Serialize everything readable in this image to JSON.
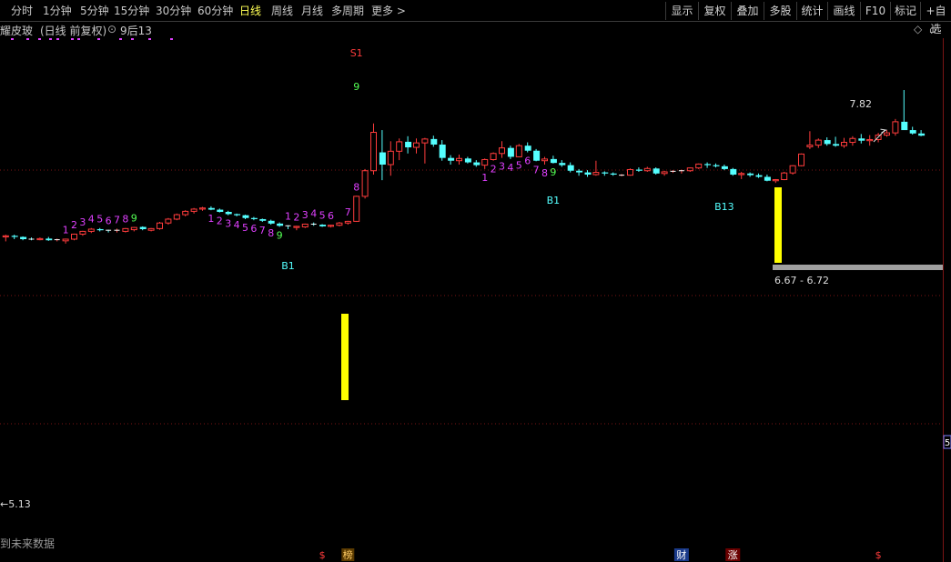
{
  "toolbar": {
    "periods": [
      "分时",
      "1分钟",
      "5分钟",
      "15分钟",
      "30分钟",
      "60分钟",
      "日线",
      "周线",
      "月线",
      "多周期",
      "更多 >"
    ],
    "active_period": "日线",
    "right_buttons": [
      "显示",
      "复权",
      "叠加",
      "多股",
      "统计",
      "画线",
      "F10",
      "标记",
      "+自选"
    ]
  },
  "infobar": {
    "stock_name": "耀皮玻",
    "mode": "(日线 前复权)",
    "indicator": "9后13",
    "right_icons": [
      "diamond-icon",
      "up-icon",
      "gear-icon"
    ]
  },
  "chart_data": {
    "type": "candlestick",
    "price_high_label": "7.82",
    "price_low_label": "5.13",
    "zone_label": "6.67 - 6.72",
    "right_axis_partial": "5",
    "footer_text": "到未来数据",
    "colors": {
      "up": "#ff3c3c",
      "down": "#54ffff",
      "gridline": "#7a1414",
      "signal_purple": "#e040ff",
      "signal_green": "#54ff54",
      "signal_cyan": "#54ffff",
      "zone_yellow": "#ffff00",
      "zone_gray": "#a0a0a0"
    },
    "candles": [
      [
        5.18,
        5.22,
        5.1,
        5.2
      ],
      [
        5.2,
        5.22,
        5.14,
        5.18
      ],
      [
        5.18,
        5.19,
        5.12,
        5.14
      ],
      [
        5.14,
        5.17,
        5.12,
        5.13
      ],
      [
        5.13,
        5.17,
        5.12,
        5.15
      ],
      [
        5.15,
        5.18,
        5.11,
        5.12
      ],
      [
        5.12,
        5.15,
        5.1,
        5.13
      ],
      [
        5.11,
        5.15,
        5.06,
        5.14
      ],
      [
        5.14,
        5.24,
        5.12,
        5.23
      ],
      [
        5.23,
        5.29,
        5.2,
        5.28
      ],
      [
        5.28,
        5.34,
        5.25,
        5.32
      ],
      [
        5.32,
        5.34,
        5.28,
        5.3
      ],
      [
        5.3,
        5.31,
        5.26,
        5.29
      ],
      [
        5.29,
        5.33,
        5.26,
        5.3
      ],
      [
        5.28,
        5.34,
        5.26,
        5.33
      ],
      [
        5.31,
        5.36,
        5.28,
        5.35
      ],
      [
        5.36,
        5.37,
        5.3,
        5.32
      ],
      [
        5.3,
        5.34,
        5.28,
        5.33
      ],
      [
        5.33,
        5.45,
        5.31,
        5.43
      ],
      [
        5.43,
        5.52,
        5.4,
        5.5
      ],
      [
        5.5,
        5.6,
        5.48,
        5.58
      ],
      [
        5.58,
        5.66,
        5.55,
        5.64
      ],
      [
        5.64,
        5.7,
        5.6,
        5.68
      ],
      [
        5.68,
        5.72,
        5.65,
        5.7
      ],
      [
        5.7,
        5.73,
        5.66,
        5.67
      ],
      [
        5.67,
        5.69,
        5.62,
        5.63
      ],
      [
        5.63,
        5.65,
        5.57,
        5.59
      ],
      [
        5.59,
        5.6,
        5.55,
        5.57
      ],
      [
        5.57,
        5.58,
        5.5,
        5.52
      ],
      [
        5.52,
        5.54,
        5.48,
        5.5
      ],
      [
        5.5,
        5.51,
        5.45,
        5.47
      ],
      [
        5.47,
        5.49,
        5.4,
        5.42
      ],
      [
        5.42,
        5.44,
        5.36,
        5.38
      ],
      [
        5.38,
        5.39,
        5.32,
        5.37
      ],
      [
        5.35,
        5.38,
        5.3,
        5.37
      ],
      [
        5.36,
        5.42,
        5.34,
        5.41
      ],
      [
        5.41,
        5.44,
        5.38,
        5.4
      ],
      [
        5.4,
        5.41,
        5.36,
        5.37
      ],
      [
        5.37,
        5.4,
        5.35,
        5.39
      ],
      [
        5.39,
        5.45,
        5.37,
        5.43
      ],
      [
        5.43,
        5.47,
        5.4,
        5.46
      ],
      [
        5.46,
        5.92,
        5.45,
        5.91
      ],
      [
        5.91,
        6.4,
        5.87,
        6.37
      ],
      [
        6.37,
        7.22,
        6.3,
        7.06
      ],
      [
        6.7,
        7.1,
        6.2,
        6.48
      ],
      [
        6.48,
        6.9,
        6.28,
        6.72
      ],
      [
        6.72,
        6.95,
        6.56,
        6.89
      ],
      [
        6.89,
        6.99,
        6.68,
        6.79
      ],
      [
        6.79,
        6.95,
        6.68,
        6.87
      ],
      [
        6.87,
        6.96,
        6.5,
        6.94
      ],
      [
        6.94,
        7.0,
        6.8,
        6.84
      ],
      [
        6.84,
        6.92,
        6.55,
        6.6
      ],
      [
        6.6,
        6.65,
        6.48,
        6.55
      ],
      [
        6.55,
        6.66,
        6.48,
        6.59
      ],
      [
        6.59,
        6.62,
        6.5,
        6.52
      ],
      [
        6.52,
        6.56,
        6.44,
        6.47
      ],
      [
        6.47,
        6.59,
        6.4,
        6.57
      ],
      [
        6.57,
        6.7,
        6.55,
        6.68
      ],
      [
        6.68,
        6.9,
        6.6,
        6.78
      ],
      [
        6.78,
        6.82,
        6.58,
        6.62
      ],
      [
        6.62,
        6.85,
        6.62,
        6.82
      ],
      [
        6.82,
        6.88,
        6.7,
        6.73
      ],
      [
        6.73,
        6.76,
        6.54,
        6.55
      ],
      [
        6.55,
        6.62,
        6.48,
        6.58
      ],
      [
        6.58,
        6.64,
        6.5,
        6.51
      ],
      [
        6.51,
        6.56,
        6.44,
        6.47
      ],
      [
        6.47,
        6.52,
        6.34,
        6.37
      ],
      [
        6.37,
        6.4,
        6.28,
        6.34
      ],
      [
        6.34,
        6.38,
        6.26,
        6.3
      ],
      [
        6.3,
        6.55,
        6.28,
        6.34
      ],
      [
        6.34,
        6.36,
        6.28,
        6.32
      ],
      [
        6.32,
        6.34,
        6.28,
        6.3
      ],
      [
        6.28,
        6.31,
        6.27,
        6.29
      ],
      [
        6.29,
        6.41,
        6.28,
        6.39
      ],
      [
        6.39,
        6.43,
        6.35,
        6.37
      ],
      [
        6.37,
        6.44,
        6.35,
        6.41
      ],
      [
        6.41,
        6.43,
        6.3,
        6.32
      ],
      [
        6.32,
        6.37,
        6.28,
        6.35
      ],
      [
        6.35,
        6.38,
        6.33,
        6.36
      ],
      [
        6.36,
        6.39,
        6.32,
        6.37
      ],
      [
        6.37,
        6.43,
        6.35,
        6.42
      ],
      [
        6.42,
        6.5,
        6.4,
        6.49
      ],
      [
        6.49,
        6.52,
        6.42,
        6.47
      ],
      [
        6.47,
        6.5,
        6.43,
        6.45
      ],
      [
        6.45,
        6.48,
        6.38,
        6.4
      ],
      [
        6.4,
        6.42,
        6.28,
        6.3
      ],
      [
        6.3,
        6.35,
        6.22,
        6.32
      ],
      [
        6.32,
        6.34,
        6.26,
        6.29
      ],
      [
        6.29,
        6.32,
        6.24,
        6.26
      ],
      [
        6.26,
        6.3,
        6.18,
        6.19
      ],
      [
        6.19,
        6.22,
        6.15,
        6.21
      ],
      [
        6.21,
        6.35,
        6.2,
        6.33
      ],
      [
        6.33,
        6.47,
        6.3,
        6.46
      ],
      [
        6.46,
        6.68,
        6.45,
        6.67
      ],
      [
        6.8,
        7.08,
        6.76,
        6.83
      ],
      [
        6.83,
        6.95,
        6.78,
        6.92
      ],
      [
        6.92,
        6.97,
        6.82,
        6.85
      ],
      [
        6.85,
        6.98,
        6.8,
        6.82
      ],
      [
        6.82,
        6.96,
        6.78,
        6.88
      ],
      [
        6.88,
        6.99,
        6.82,
        6.95
      ],
      [
        6.95,
        7.03,
        6.86,
        6.91
      ],
      [
        6.91,
        7.01,
        6.82,
        6.93
      ],
      [
        6.93,
        7.05,
        6.88,
        7.01
      ],
      [
        7.01,
        7.1,
        6.98,
        7.05
      ],
      [
        7.05,
        7.3,
        7.0,
        7.25
      ],
      [
        7.25,
        7.82,
        7.15,
        7.1
      ],
      [
        7.1,
        7.16,
        7.02,
        7.04
      ],
      [
        7.04,
        7.1,
        6.99,
        7.0
      ]
    ],
    "markers": [
      {
        "i": 7,
        "t": "1",
        "c": "purple",
        "pos": "above"
      },
      {
        "i": 8,
        "t": "2",
        "c": "purple",
        "pos": "above"
      },
      {
        "i": 9,
        "t": "3",
        "c": "purple",
        "pos": "above"
      },
      {
        "i": 10,
        "t": "4",
        "c": "purple",
        "pos": "above"
      },
      {
        "i": 11,
        "t": "5",
        "c": "purple",
        "pos": "above"
      },
      {
        "i": 12,
        "t": "6",
        "c": "purple",
        "pos": "above"
      },
      {
        "i": 13,
        "t": "7",
        "c": "purple",
        "pos": "above"
      },
      {
        "i": 14,
        "t": "8",
        "c": "purple",
        "pos": "above"
      },
      {
        "i": 15,
        "t": "9",
        "c": "green",
        "pos": "above"
      },
      {
        "i": 24,
        "t": "1",
        "c": "purple",
        "pos": "below"
      },
      {
        "i": 25,
        "t": "2",
        "c": "purple",
        "pos": "below"
      },
      {
        "i": 26,
        "t": "3",
        "c": "purple",
        "pos": "below"
      },
      {
        "i": 27,
        "t": "4",
        "c": "purple",
        "pos": "below"
      },
      {
        "i": 28,
        "t": "5",
        "c": "purple",
        "pos": "below"
      },
      {
        "i": 29,
        "t": "6",
        "c": "purple",
        "pos": "below"
      },
      {
        "i": 30,
        "t": "7",
        "c": "purple",
        "pos": "below"
      },
      {
        "i": 31,
        "t": "8",
        "c": "purple",
        "pos": "below"
      },
      {
        "i": 32,
        "t": "9",
        "c": "green",
        "pos": "below"
      },
      {
        "i": 33,
        "t": "B1",
        "c": "cyan",
        "pos": "far"
      },
      {
        "i": 33,
        "t": "1",
        "c": "purple",
        "pos": "above"
      },
      {
        "i": 34,
        "t": "2",
        "c": "purple",
        "pos": "above"
      },
      {
        "i": 35,
        "t": "3",
        "c": "purple",
        "pos": "above"
      },
      {
        "i": 36,
        "t": "4",
        "c": "purple",
        "pos": "above"
      },
      {
        "i": 37,
        "t": "5",
        "c": "purple",
        "pos": "above"
      },
      {
        "i": 38,
        "t": "6",
        "c": "purple",
        "pos": "above"
      },
      {
        "i": 40,
        "t": "7",
        "c": "purple",
        "pos": "above"
      },
      {
        "i": 41,
        "t": "8",
        "c": "purple",
        "pos": "above"
      },
      {
        "i": 41,
        "t": "9",
        "c": "green",
        "pos": "top9"
      },
      {
        "i": 41,
        "t": "S1",
        "c": "red",
        "pos": "top"
      },
      {
        "i": 56,
        "t": "1",
        "c": "purple",
        "pos": "below"
      },
      {
        "i": 57,
        "t": "2",
        "c": "purple",
        "pos": "below"
      },
      {
        "i": 58,
        "t": "3",
        "c": "purple",
        "pos": "below"
      },
      {
        "i": 59,
        "t": "4",
        "c": "purple",
        "pos": "below"
      },
      {
        "i": 60,
        "t": "5",
        "c": "purple",
        "pos": "below"
      },
      {
        "i": 61,
        "t": "6",
        "c": "purple",
        "pos": "below"
      },
      {
        "i": 62,
        "t": "7",
        "c": "purple",
        "pos": "below"
      },
      {
        "i": 63,
        "t": "8",
        "c": "purple",
        "pos": "below"
      },
      {
        "i": 64,
        "t": "9",
        "c": "green",
        "pos": "below"
      },
      {
        "i": 64,
        "t": "B1",
        "c": "cyan",
        "pos": "far"
      },
      {
        "i": 84,
        "t": "B13",
        "c": "cyan",
        "pos": "far"
      }
    ],
    "bottom_labels": [
      {
        "i": 37,
        "t": "$",
        "c": "red"
      },
      {
        "i": 40,
        "t": "榜",
        "c": "badge"
      },
      {
        "i": 79,
        "t": "财",
        "c": "blue"
      },
      {
        "i": 85,
        "t": "涨",
        "c": "redbadge"
      },
      {
        "i": 102,
        "t": "$",
        "c": "red"
      }
    ]
  }
}
